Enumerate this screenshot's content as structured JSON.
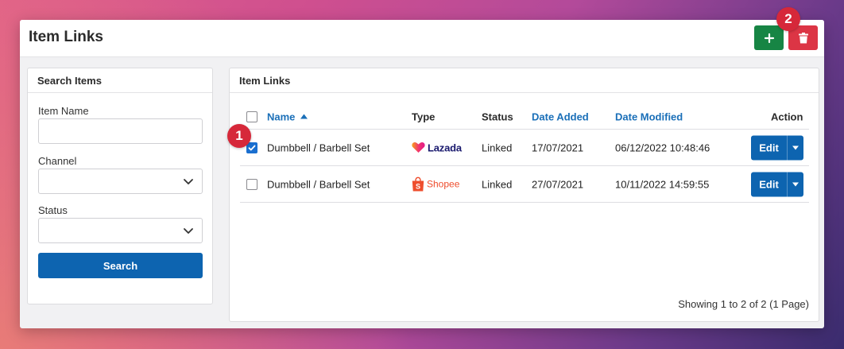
{
  "window": {
    "title": "Item Links"
  },
  "header_buttons": {
    "add_icon": "plus-icon",
    "delete_icon": "trash-icon",
    "add_color": "#178544",
    "delete_color": "#dc3545"
  },
  "search_panel": {
    "title": "Search Items",
    "item_name_label": "Item Name",
    "item_name_value": "",
    "channel_label": "Channel",
    "channel_value": "",
    "status_label": "Status",
    "status_value": "",
    "search_button": "Search"
  },
  "links_panel": {
    "title": "Item Links",
    "columns": {
      "name": "Name",
      "type": "Type",
      "status": "Status",
      "date_added": "Date Added",
      "date_modified": "Date Modified",
      "action": "Action"
    },
    "rows": [
      {
        "checked": true,
        "name": "Dumbbell / Barbell Set",
        "type": "Lazada",
        "status": "Linked",
        "date_added": "17/07/2021",
        "date_modified": "06/12/2022 10:48:46",
        "action": "Edit"
      },
      {
        "checked": false,
        "name": "Dumbbell / Barbell Set",
        "type": "Shopee",
        "status": "Linked",
        "date_added": "27/07/2021",
        "date_modified": "10/11/2022 14:59:55",
        "action": "Edit"
      }
    ],
    "footer": "Showing 1 to 2 of 2 (1 Page)"
  },
  "badges": {
    "one": "1",
    "two": "2"
  },
  "colors": {
    "primary": "#0d64b0",
    "link": "#1a6fb8",
    "badge": "#d6283a",
    "lazada": "#1a1a6e",
    "shopee": "#ee4d2d"
  }
}
